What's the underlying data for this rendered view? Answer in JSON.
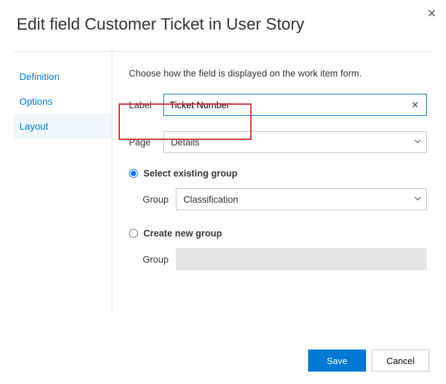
{
  "dialog": {
    "title": "Edit field Customer Ticket in User Story"
  },
  "sidebar": {
    "items": [
      {
        "label": "Definition",
        "selected": false
      },
      {
        "label": "Options",
        "selected": false
      },
      {
        "label": "Layout",
        "selected": true
      }
    ]
  },
  "main": {
    "intro": "Choose how the field is displayed on the work item form.",
    "label_field_label": "Label",
    "label_value": "Ticket Number",
    "page_field_label": "Page",
    "page_value": "Details",
    "existing_group_label": "Select existing group",
    "group_field_label": "Group",
    "group_value": "Classification",
    "new_group_label": "Create new group",
    "new_group_field_label": "Group"
  },
  "footer": {
    "save": "Save",
    "cancel": "Cancel"
  }
}
